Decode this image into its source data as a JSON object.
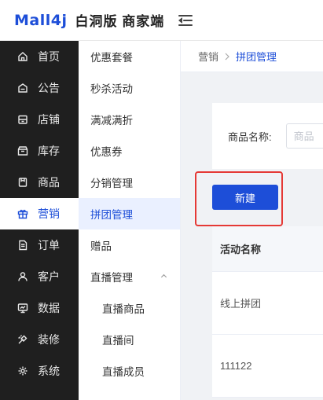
{
  "header": {
    "brand": "Mall4j",
    "subtitle": "白洞版 商家端"
  },
  "sidebar": {
    "items": [
      {
        "label": "首页",
        "icon": "home-icon"
      },
      {
        "label": "公告",
        "icon": "announcement-icon"
      },
      {
        "label": "店铺",
        "icon": "store-icon"
      },
      {
        "label": "库存",
        "icon": "inventory-icon"
      },
      {
        "label": "商品",
        "icon": "product-icon"
      },
      {
        "label": "营销",
        "icon": "gift-icon",
        "active": true
      },
      {
        "label": "订单",
        "icon": "order-icon"
      },
      {
        "label": "客户",
        "icon": "customer-icon"
      },
      {
        "label": "数据",
        "icon": "data-icon"
      },
      {
        "label": "装修",
        "icon": "decoration-icon"
      },
      {
        "label": "系统",
        "icon": "system-icon"
      }
    ]
  },
  "submenu": {
    "items": [
      {
        "label": "优惠套餐"
      },
      {
        "label": "秒杀活动"
      },
      {
        "label": "满减满折"
      },
      {
        "label": "优惠券"
      },
      {
        "label": "分销管理"
      },
      {
        "label": "拼团管理",
        "active": true
      },
      {
        "label": "赠品"
      },
      {
        "label": "直播管理",
        "expanded": true
      },
      {
        "label": "直播商品",
        "sub": true
      },
      {
        "label": "直播间",
        "sub": true
      },
      {
        "label": "直播成员",
        "sub": true
      }
    ]
  },
  "breadcrumb": {
    "first": "营销",
    "last": "拼团管理"
  },
  "search": {
    "label": "商品名称:",
    "placeholder": "商品"
  },
  "toolbar": {
    "new_label": "新建"
  },
  "table": {
    "header": "活动名称",
    "rows": [
      "线上拼团",
      "111122"
    ]
  },
  "colors": {
    "accent": "#1d4ed8",
    "sidebar_bg": "#1f1f1f",
    "highlight": "#e53935"
  }
}
